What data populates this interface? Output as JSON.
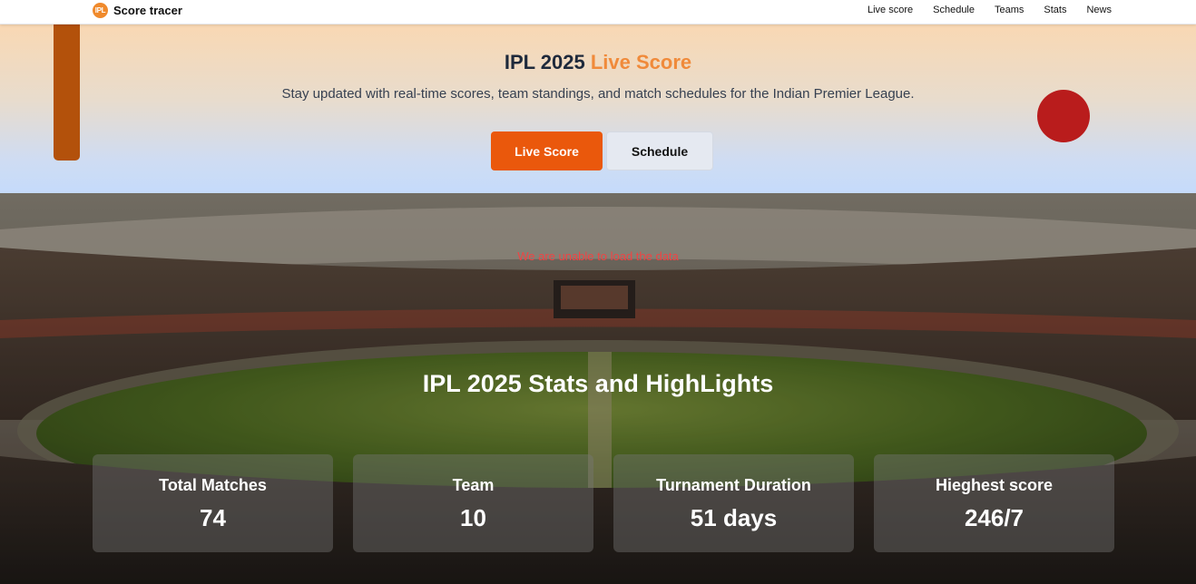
{
  "nav": {
    "logo_text": "IPL",
    "brand": "Score tracer",
    "links": [
      "Live score",
      "Schedule",
      "Teams",
      "Stats",
      "News"
    ]
  },
  "hero": {
    "title_main": "IPL 2025",
    "title_accent": "Live Score",
    "subtitle": "Stay updated with real-time scores, team standings, and match schedules for the Indian Premier League.",
    "primary_button": "Live Score",
    "secondary_button": "Schedule"
  },
  "stats": {
    "error": "We are unable to load the data",
    "title": "IPL 2025 Stats and HighLights",
    "cards": [
      {
        "label": "Total Matches",
        "value": "74"
      },
      {
        "label": "Team",
        "value": "10"
      },
      {
        "label": "Turnament Duration",
        "value": "51 days"
      },
      {
        "label": "Hieghest score",
        "value": "246/7"
      }
    ]
  },
  "colors": {
    "accent": "#f08a3a",
    "primary_button": "#ea580c",
    "error": "#ef4444"
  }
}
